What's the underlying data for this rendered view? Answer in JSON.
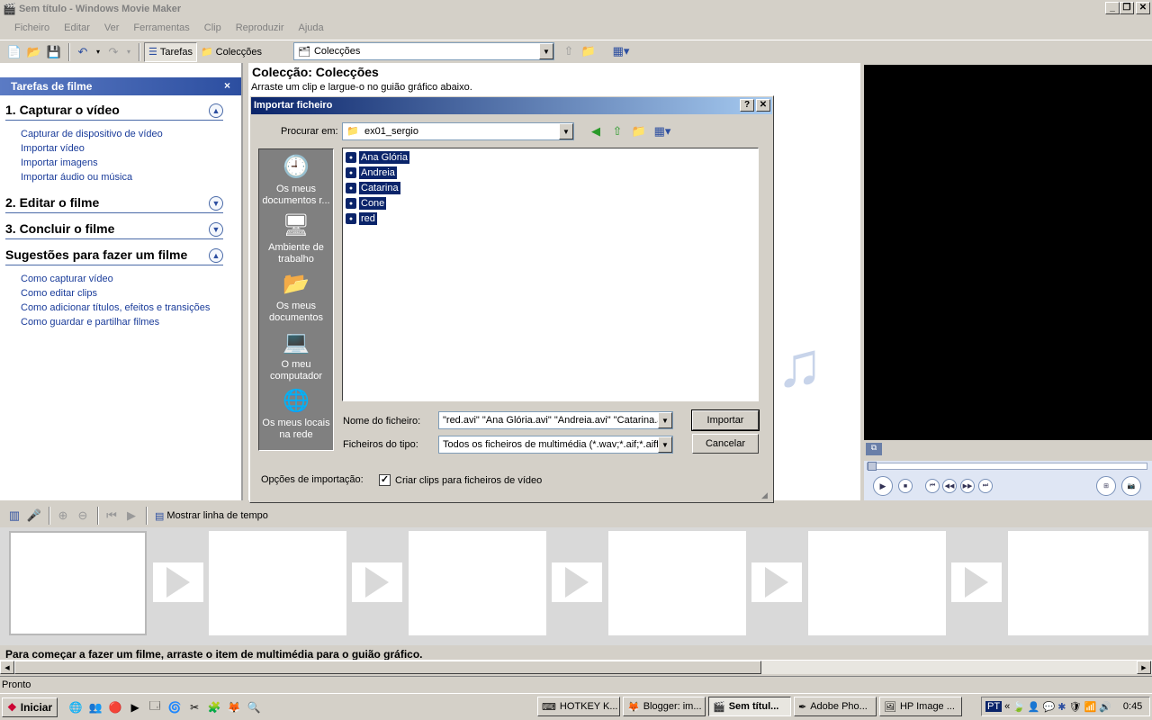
{
  "window": {
    "title": "Sem título - Windows Movie Maker",
    "controls": [
      "_",
      "❐",
      "✕"
    ]
  },
  "menu": [
    "Ficheiro",
    "Editar",
    "Ver",
    "Ferramentas",
    "Clip",
    "Reproduzir",
    "Ajuda"
  ],
  "toolbar": {
    "tasks_label": "Tarefas",
    "collections_label": "Colecções",
    "collection_combo": "Colecções"
  },
  "taskpane": {
    "header": "Tarefas de filme",
    "close": "×",
    "sections": [
      {
        "title": "1. Capturar o vídeo",
        "links": [
          "Capturar de dispositivo de vídeo",
          "Importar vídeo",
          "Importar imagens",
          "Importar áudio ou música"
        ]
      },
      {
        "title": "2. Editar o filme"
      },
      {
        "title": "3. Concluir o filme"
      },
      {
        "title": "Sugestões para fazer um filme",
        "links": [
          "Como capturar vídeo",
          "Como editar clips",
          "Como adicionar títulos, efeitos e transições",
          "Como guardar e partilhar filmes"
        ]
      }
    ]
  },
  "collection": {
    "title": "Colecção: Colecções",
    "subtitle": "Arraste um clip e largue-o no guião gráfico abaixo."
  },
  "dialog": {
    "title": "Importar ficheiro",
    "help": "?",
    "close": "✕",
    "look_in_label": "Procurar em:",
    "look_in_value": "ex01_sergio",
    "places": [
      "Os meus documentos r...",
      "Ambiente de trabalho",
      "Os meus documentos",
      "O meu computador",
      "Os meus locais na rede"
    ],
    "files": [
      "Ana Glória",
      "Andreia",
      "Catarina",
      "Cone",
      "red"
    ],
    "filename_label": "Nome do ficheiro:",
    "filename_value": "\"red.avi\" \"Ana Glória.avi\" \"Andreia.avi\" \"Catarina.a",
    "filetype_label": "Ficheiros do tipo:",
    "filetype_value": "Todos os ficheiros de multimédia (*.wav;*.aif;*.aiff;*.",
    "import_button": "Importar",
    "cancel_button": "Cancelar",
    "options_label": "Opções de importação:",
    "checkbox_label": "Criar clips para ficheiros de vídeo",
    "checkbox_checked": true
  },
  "storyboard": {
    "timeline_label": "Mostrar linha de tempo",
    "message": "Para começar a fazer um filme, arraste o item de multimédia para o guião gráfico."
  },
  "status": "Pronto",
  "taskbar": {
    "start": "Iniciar",
    "apps": [
      "HOTKEY K...",
      "Blogger: im...",
      "Sem títul...",
      "Adobe Pho...",
      "HP Image ..."
    ],
    "lang": "PT",
    "clock": "0:45"
  }
}
